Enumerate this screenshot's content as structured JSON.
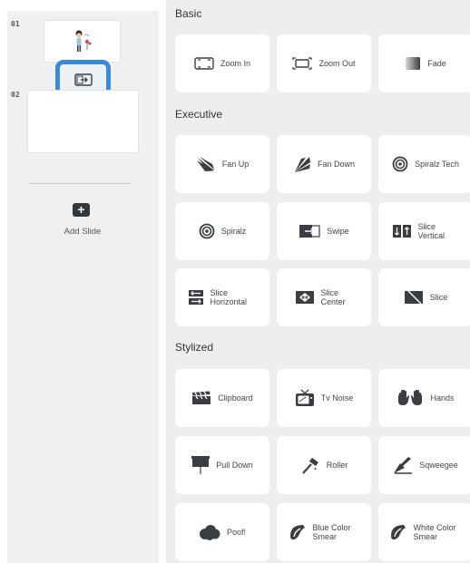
{
  "slides_panel": {
    "slides": [
      {
        "number": "01"
      },
      {
        "number": "02"
      }
    ],
    "add_slide_label": "Add Slide"
  },
  "transitions": {
    "sections": [
      {
        "title": "Basic",
        "items": [
          {
            "label": "Zoom In",
            "icon": "zoom-in-icon"
          },
          {
            "label": "Zoom Out",
            "icon": "zoom-out-icon"
          },
          {
            "label": "Fade",
            "icon": "fade-icon"
          }
        ]
      },
      {
        "title": "Executive",
        "items": [
          {
            "label": "Fan Up",
            "icon": "fan-up-icon"
          },
          {
            "label": "Fan Down",
            "icon": "fan-down-icon"
          },
          {
            "label": "Spiralz Tech",
            "icon": "spiral-tech-icon"
          },
          {
            "label": "Spiralz",
            "icon": "spiral-icon"
          },
          {
            "label": "Swipe",
            "icon": "swipe-icon"
          },
          {
            "label": "Slice Vertical",
            "icon": "slice-vertical-icon"
          },
          {
            "label": "Slice Horizontal",
            "icon": "slice-horizontal-icon"
          },
          {
            "label": "Slice Center",
            "icon": "slice-center-icon"
          },
          {
            "label": "Slice",
            "icon": "slice-icon"
          }
        ]
      },
      {
        "title": "Stylized",
        "items": [
          {
            "label": "Clipboard",
            "icon": "clipboard-icon"
          },
          {
            "label": "Tv Noise",
            "icon": "tv-icon"
          },
          {
            "label": "Hands",
            "icon": "hands-icon"
          },
          {
            "label": "Pull Down",
            "icon": "pull-down-icon"
          },
          {
            "label": "Roller",
            "icon": "roller-icon"
          },
          {
            "label": "Sqweegee",
            "icon": "squeegee-icon"
          },
          {
            "label": "Poof!",
            "icon": "poof-icon"
          },
          {
            "label": "Blue Color Smear",
            "icon": "smear-icon"
          },
          {
            "label": "White Color Smear",
            "icon": "smear-icon"
          }
        ]
      }
    ]
  },
  "colors": {
    "accent": "#3a8ad8",
    "icon": "#3a3d42",
    "panel_bg": "#eeeef0"
  }
}
